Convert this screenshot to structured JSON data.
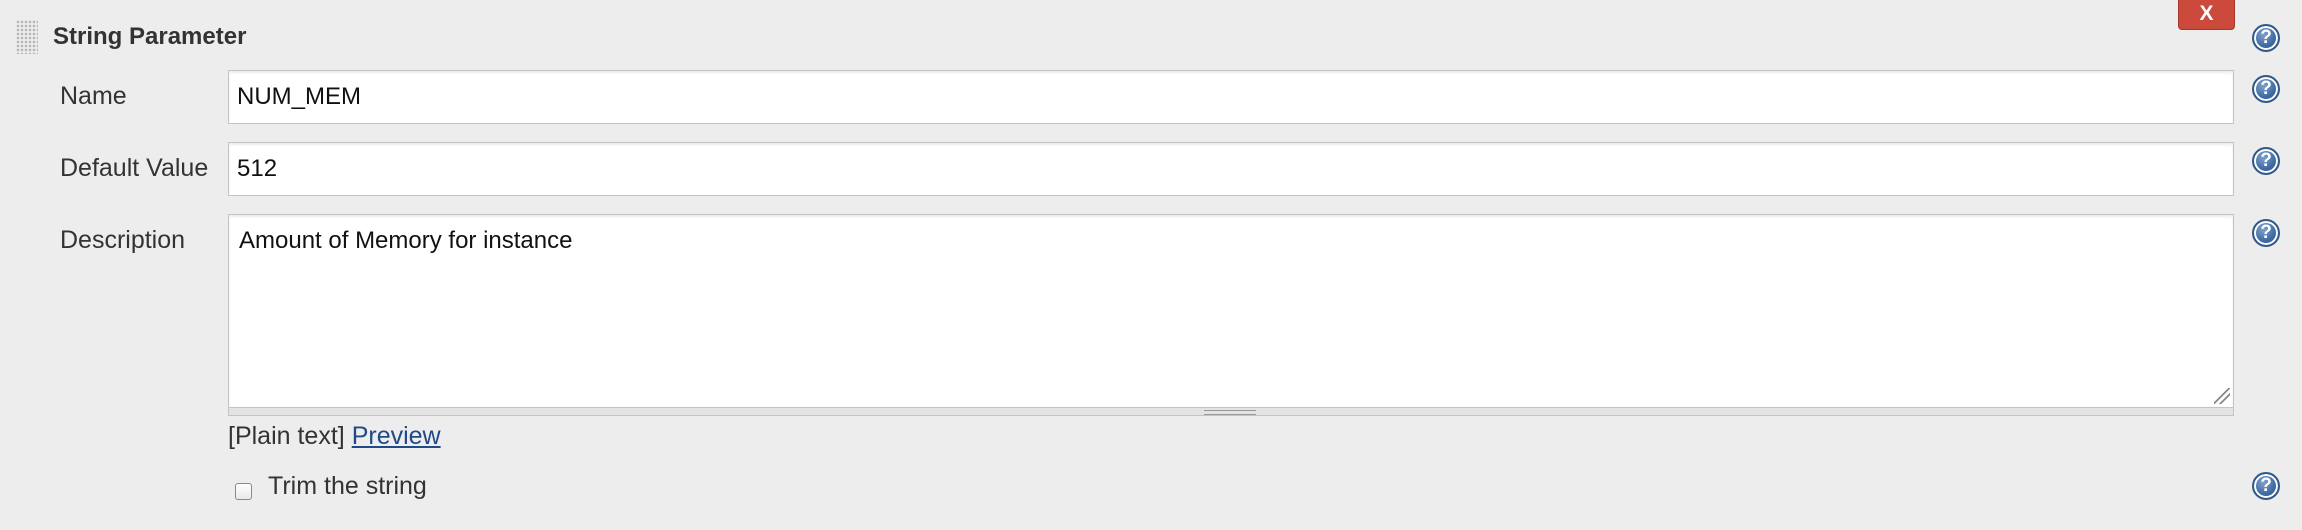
{
  "section": {
    "title": "String Parameter",
    "close_label": "X"
  },
  "help_icon_glyph": "?",
  "fields": {
    "name": {
      "label": "Name",
      "value": "NUM_MEM"
    },
    "default_value": {
      "label": "Default Value",
      "value": "512"
    },
    "description": {
      "label": "Description",
      "value": "Amount of Memory for instance"
    }
  },
  "format": {
    "plain_text_label": "[Plain text]",
    "preview_label": "Preview"
  },
  "trim": {
    "label": "Trim the string",
    "checked": false
  },
  "colors": {
    "background": "#ededed",
    "close_button": "#cc4a3c",
    "help_icon": "#3f6aa0",
    "link": "#204a87"
  },
  "icons": {
    "drag_handle": "drag-handle-icon",
    "help": "help-icon",
    "close": "close-icon"
  }
}
